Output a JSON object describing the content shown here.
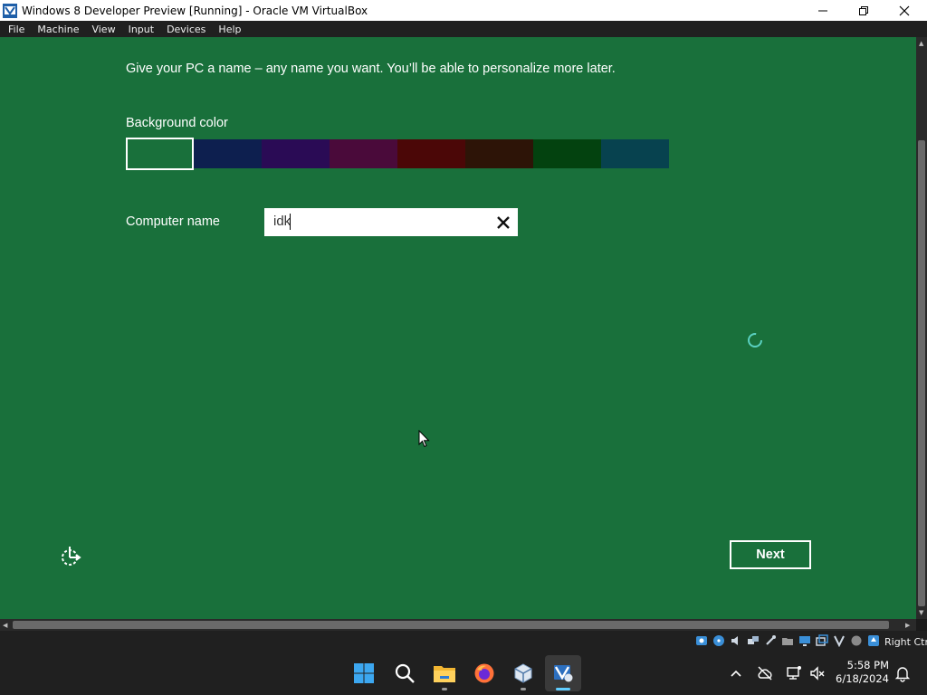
{
  "window": {
    "title": "Windows 8 Developer Preview [Running] - Oracle VM VirtualBox",
    "menu": [
      "File",
      "Machine",
      "View",
      "Input",
      "Devices",
      "Help"
    ]
  },
  "setup": {
    "intro": "Give your PC a name – any name you want. You’ll be able to personalize more later.",
    "background_label": "Background color",
    "swatch_colors": [
      "#19703b",
      "#0d1f4f",
      "#2a0b55",
      "#4a0a3a",
      "#4b0707",
      "#2d1407",
      "#03420f",
      "#07424f"
    ],
    "selected_swatch": 0,
    "computer_name_label": "Computer name",
    "computer_name_value": "idk",
    "next_label": "Next"
  },
  "statusbar": {
    "host_key": "Right Ctrl"
  },
  "taskbar": {
    "apps": [
      "start-icon",
      "search-icon",
      "file-explorer-icon",
      "firefox-icon",
      "virtualbox-icon",
      "virtualbox-vm-icon"
    ],
    "time": "5:58 PM",
    "date": "6/18/2024"
  },
  "colors": {
    "guest_background": "#19703b",
    "taskbar": "#202020",
    "accent": "#60cdff"
  }
}
